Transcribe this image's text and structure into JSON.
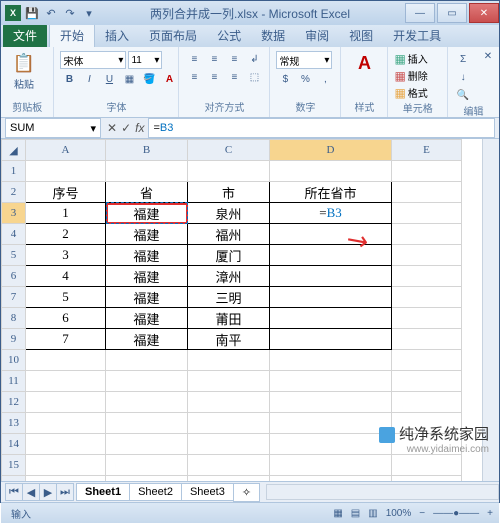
{
  "window": {
    "title": "两列合并成一列.xlsx - Microsoft Excel"
  },
  "qat": {
    "save": "💾",
    "undo": "↶",
    "redo": "↷"
  },
  "tabs": {
    "file": "文件",
    "home": "开始",
    "insert": "插入",
    "layout": "页面布局",
    "formulas": "公式",
    "data": "数据",
    "review": "审阅",
    "view": "视图",
    "dev": "开发工具"
  },
  "ribbon": {
    "clipboard": {
      "paste": "粘贴",
      "label": "剪贴板"
    },
    "font": {
      "name": "宋体",
      "size": "11",
      "label": "字体"
    },
    "align": {
      "label": "对齐方式"
    },
    "number": {
      "fmt": "常规",
      "pct": "%",
      "label": "数字"
    },
    "styles": {
      "format_btn": "A",
      "label": "样式"
    },
    "cells": {
      "insert": "插入",
      "delete": "删除",
      "format": "格式",
      "label": "单元格"
    },
    "editing": {
      "sum": "Σ",
      "label": "编辑"
    }
  },
  "formula_bar": {
    "name_box": "SUM",
    "fx": "fx",
    "formula_prefix": "=",
    "formula_ref": "B3"
  },
  "columns": [
    "A",
    "B",
    "C",
    "D",
    "E"
  ],
  "headers": {
    "seq": "序号",
    "prov": "省",
    "city": "市",
    "loc": "所在省市"
  },
  "rows": [
    {
      "n": "1",
      "seq": "1",
      "prov": "福建",
      "city": "泉州"
    },
    {
      "n": "2",
      "seq": "2",
      "prov": "福建",
      "city": "福州"
    },
    {
      "n": "3",
      "seq": "3",
      "prov": "福建",
      "city": "厦门"
    },
    {
      "n": "4",
      "seq": "4",
      "prov": "福建",
      "city": "漳州"
    },
    {
      "n": "5",
      "seq": "5",
      "prov": "福建",
      "city": "三明"
    },
    {
      "n": "6",
      "seq": "6",
      "prov": "福建",
      "city": "莆田"
    },
    {
      "n": "7",
      "seq": "7",
      "prov": "福建",
      "city": "南平"
    }
  ],
  "editing_cell": {
    "prefix": "=",
    "ref": "B3"
  },
  "sheets": {
    "s1": "Sheet1",
    "s2": "Sheet2",
    "s3": "Sheet3"
  },
  "status": {
    "mode": "输入",
    "zoom": "100%"
  },
  "watermark": {
    "main": "纯净系统家园",
    "url": "www.yidaimei.com"
  }
}
